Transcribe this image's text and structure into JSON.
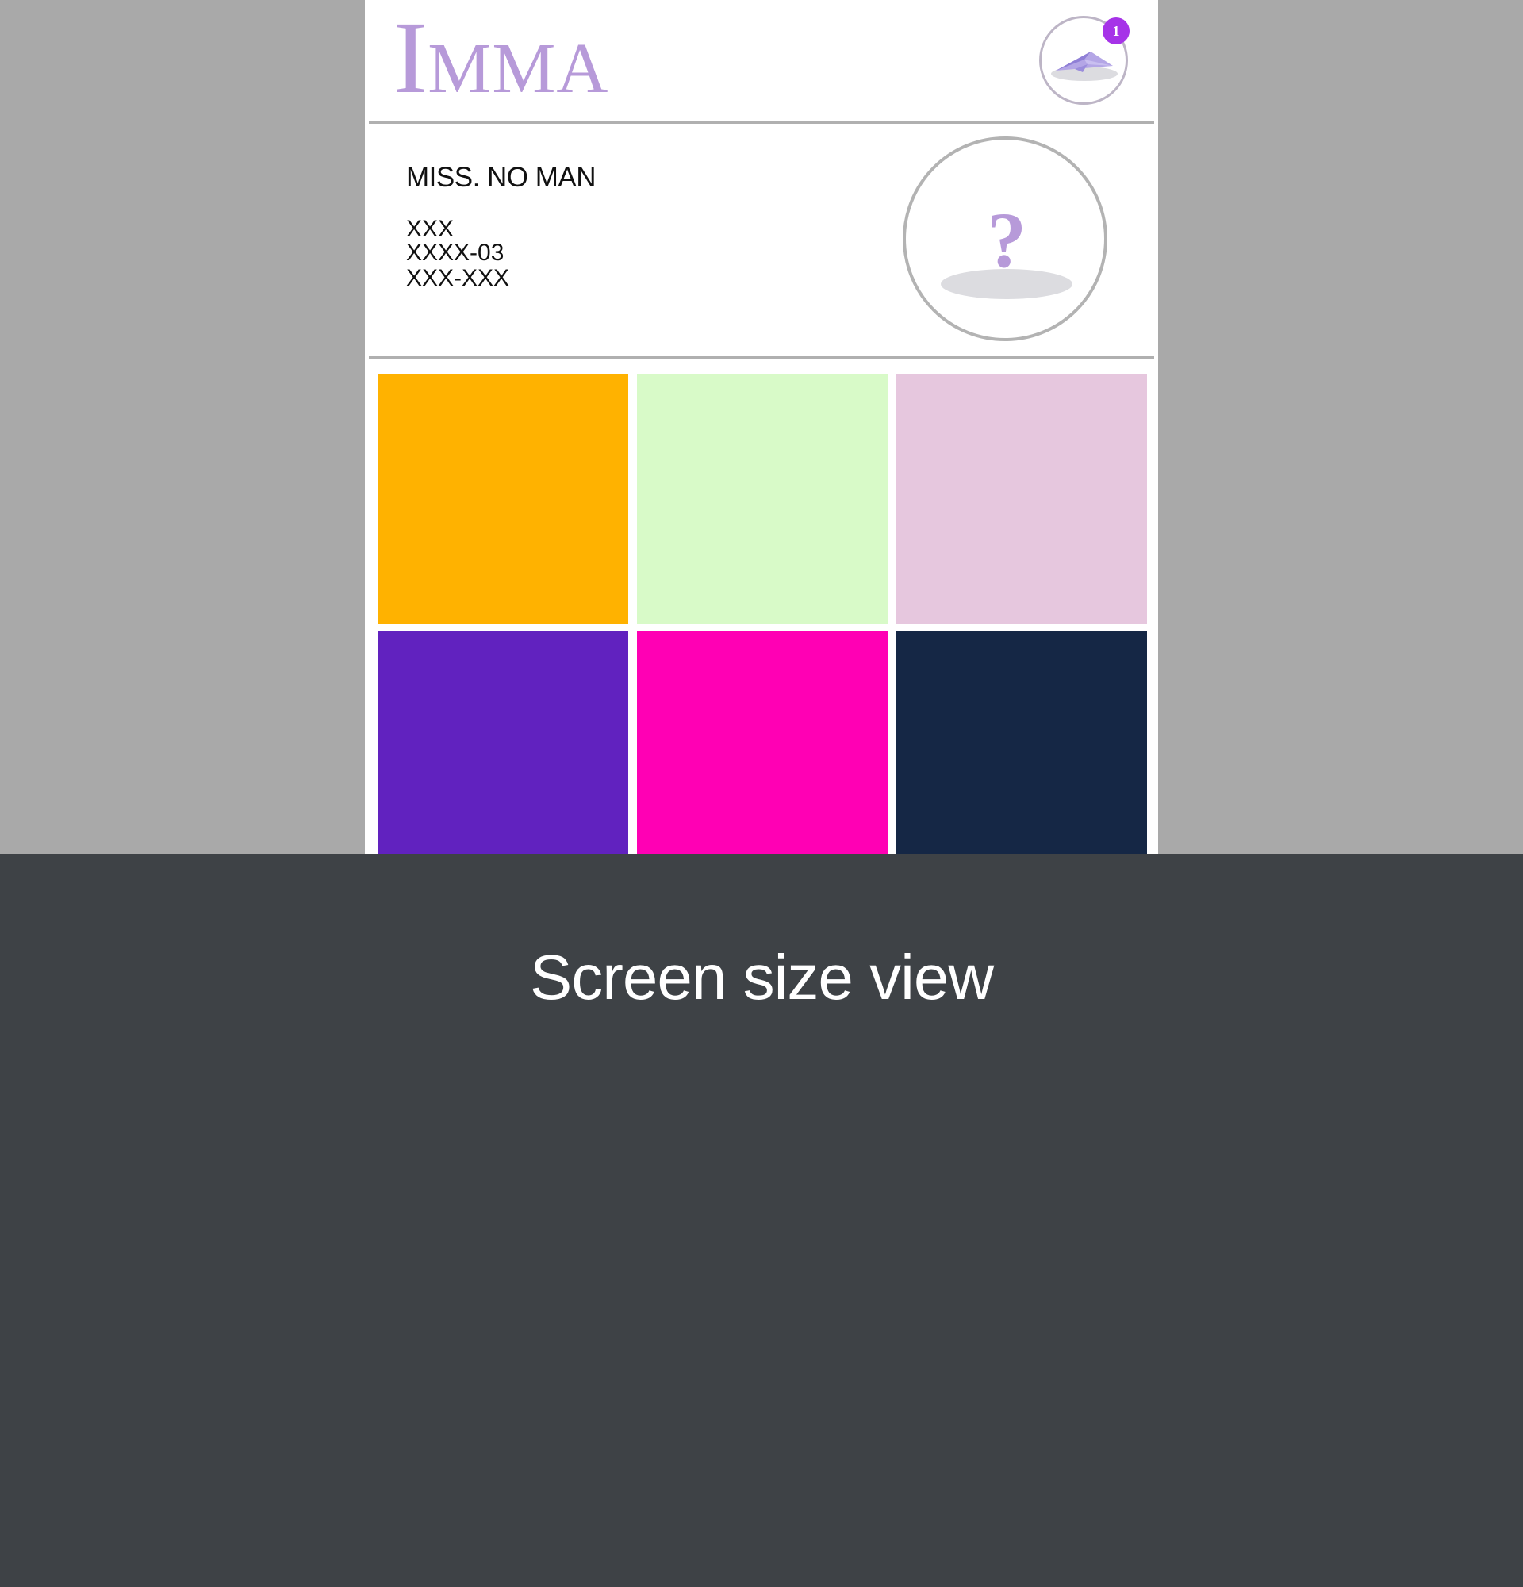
{
  "header": {
    "logo_initial": "I",
    "logo_rest": "MMA",
    "notification_count": "1",
    "notification_icon": "paper-plane-icon"
  },
  "profile": {
    "name": "MISS. NO MAN",
    "line1": "XXX",
    "line2": "XXXX-03",
    "line3": "XXX-XXX",
    "avatar_icon": "question-mark-icon",
    "avatar_glyph": "?"
  },
  "tiles": [
    {
      "color": "#ffb200"
    },
    {
      "color": "#d8fac8"
    },
    {
      "color": "#e6c7de"
    },
    {
      "color": "#6122bf"
    },
    {
      "color": "#ff00b4"
    },
    {
      "color": "#152745"
    }
  ],
  "footer": {
    "title": "Screen size view"
  },
  "colors": {
    "accent": "#b79ad9",
    "badge": "#a633e8",
    "backdrop": "#a9a9a9",
    "panel": "#3e4246"
  }
}
